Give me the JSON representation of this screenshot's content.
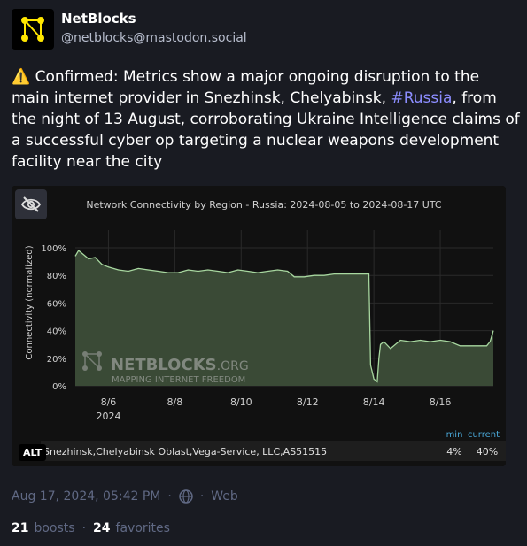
{
  "account": {
    "display_name": "NetBlocks",
    "handle": "@netblocks@mastodon.social",
    "avatar_icon": "netblocks-logo"
  },
  "status": {
    "warning_icon": "⚠️",
    "text_before": " Confirmed: Metrics show a major ongoing disruption to the main internet provider in Snezhinsk, Chelyabinsk, ",
    "hashtag": "#Russia",
    "text_after": ", from the night of 13 August, corroborating Ukraine Intelligence claims of a successful cyber op targeting a nuclear weapons development facility near the city"
  },
  "media": {
    "hide_icon": "eye-slash-icon",
    "alt_label": "ALT"
  },
  "chart_data": {
    "type": "line",
    "title": "Network Connectivity by Region - Russia: 2024-08-05 to 2024-08-17 UTC",
    "ylabel": "Connectivity (normalized)",
    "xlabel": "",
    "ylim": [
      0,
      100
    ],
    "yticks": [
      "0%",
      "20%",
      "40%",
      "60%",
      "80%",
      "100%"
    ],
    "xticks": [
      "8/6",
      "8/8",
      "8/10",
      "8/12",
      "8/14",
      "8/16"
    ],
    "xtick_year": "2024",
    "watermark_brand": "NETBLOCKS",
    "watermark_tld": ".ORG",
    "watermark_tagline": "MAPPING INTERNET FREEDOM",
    "series": [
      {
        "name": "Snezhinsk,Chelyabinsk Oblast,Vega-Service, LLC,AS51515",
        "color": "#a8d8a0",
        "x": [
          5.0,
          5.1,
          5.25,
          5.4,
          5.6,
          5.8,
          6.0,
          6.3,
          6.6,
          6.9,
          7.2,
          7.5,
          7.8,
          8.1,
          8.4,
          8.7,
          9.0,
          9.3,
          9.6,
          9.9,
          10.2,
          10.5,
          10.8,
          11.1,
          11.4,
          11.6,
          11.9,
          12.2,
          12.5,
          12.8,
          13.1,
          13.4,
          13.7,
          13.85,
          13.9,
          13.95,
          14.0,
          14.1,
          14.15,
          14.2,
          14.3,
          14.5,
          14.8,
          15.1,
          15.4,
          15.7,
          16.0,
          16.3,
          16.6,
          16.9,
          17.2,
          17.4,
          17.5,
          17.6
        ],
        "values": [
          94,
          98,
          95,
          92,
          93,
          88,
          86,
          84,
          83,
          85,
          84,
          83,
          82,
          82,
          84,
          83,
          84,
          83,
          82,
          84,
          83,
          82,
          83,
          84,
          83,
          79,
          79,
          80,
          80,
          81,
          81,
          81,
          81,
          81,
          15,
          10,
          5,
          3,
          20,
          30,
          32,
          27,
          33,
          32,
          33,
          32,
          33,
          32,
          29,
          29,
          29,
          29,
          32,
          40
        ]
      }
    ],
    "legend_headers": {
      "min": "min",
      "current": "current"
    },
    "legend_row": {
      "label": "Snezhinsk,Chelyabinsk Oblast,Vega-Service, LLC,AS51515",
      "min": "4%",
      "current": "40%"
    }
  },
  "footer": {
    "timestamp": "Aug 17, 2024, 05:42 PM",
    "dot": "·",
    "visibility_icon": "globe-icon",
    "app": "Web",
    "boosts_count": "21",
    "boosts_label": "boosts",
    "favorites_count": "24",
    "favorites_label": "favorites"
  },
  "colors": {
    "background": "#191b22",
    "text_secondary": "#606984",
    "hashtag": "#8c8dff",
    "chart_background": "#111111",
    "line": "#a8d8a0",
    "area_fill": "#3a4a36",
    "legend_header": "#4aa8d8"
  }
}
